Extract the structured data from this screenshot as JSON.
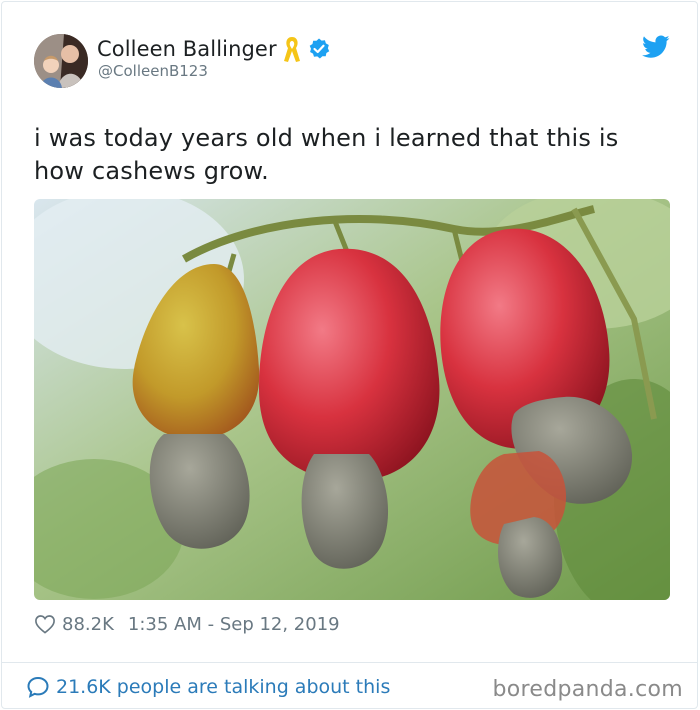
{
  "author": {
    "display_name": "Colleen Ballinger",
    "handle": "@ColleenB123",
    "verified": true
  },
  "icons": {
    "ribbon": "awareness-ribbon-icon",
    "verified": "verified-badge-icon",
    "brand": "twitter-bird-icon",
    "like": "heart-icon",
    "conversation": "speech-bubble-icon"
  },
  "tweet": {
    "text": "i was today years old when i learned that this is how cashews grow.",
    "likes": "88.2K",
    "timestamp": "1:35 AM - Sep 12, 2019"
  },
  "footer": {
    "conversation": "21.6K people are talking about this",
    "watermark": "boredpanda.com"
  },
  "colors": {
    "twitter_blue": "#1da1f2",
    "link_blue": "#2b7bb9",
    "ribbon_yellow": "#f5c518",
    "muted_text": "#697882"
  }
}
